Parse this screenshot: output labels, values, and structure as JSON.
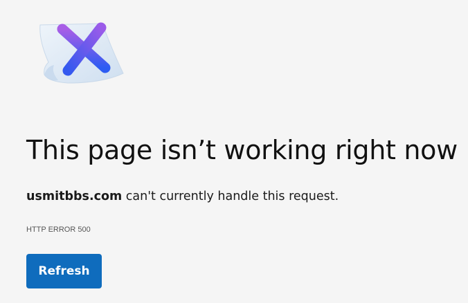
{
  "error_page": {
    "headline": "This page isn’t working right now",
    "domain": "usmitbbs.com",
    "message_suffix": " can't currently handle this request.",
    "error_code": "HTTP ERROR 500",
    "refresh_label": "Refresh"
  },
  "illustration": {
    "icon": "broken-page-x-icon",
    "colors": {
      "paper": "#dfeaf5",
      "x_top": "#a05ce8",
      "x_bottom": "#2f5bf0"
    }
  },
  "colors": {
    "background": "#f5f5f5",
    "button": "#0f6cbd",
    "button_text": "#ffffff"
  }
}
